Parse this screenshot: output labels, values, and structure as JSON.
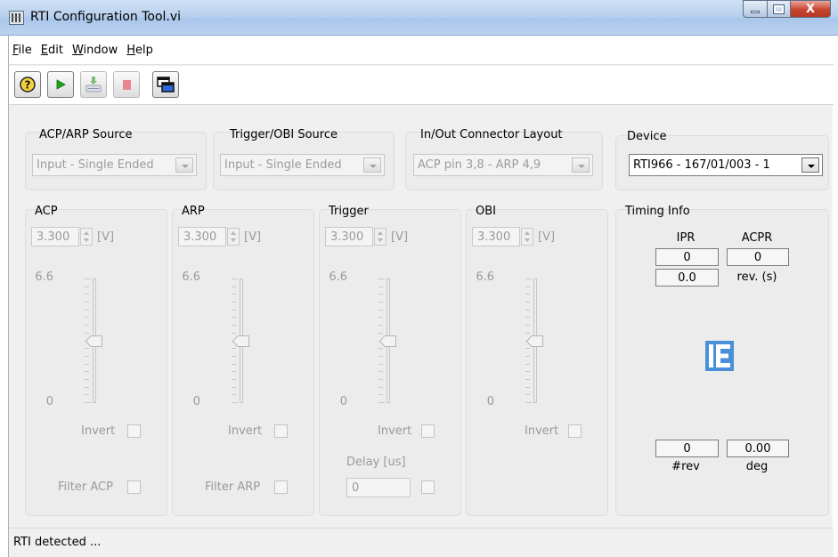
{
  "window": {
    "title": "RTI Configuration Tool.vi",
    "controls": {
      "minimize_icon": "minimize-icon",
      "maximize_icon": "maximize-icon",
      "close_glyph": "X"
    }
  },
  "menu": {
    "items": [
      {
        "accel": "F",
        "rest": "ile"
      },
      {
        "accel": "E",
        "rest": "dit"
      },
      {
        "accel": "W",
        "rest": "indow"
      },
      {
        "accel": "H",
        "rest": "elp"
      }
    ]
  },
  "toolbar": {
    "buttons": [
      {
        "icon": "help-icon",
        "enabled": true
      },
      {
        "icon": "run-icon",
        "enabled": true
      },
      {
        "icon": "download-icon",
        "enabled": false
      },
      {
        "icon": "stop-icon",
        "enabled": false
      },
      {
        "icon": "copy-windows-icon",
        "enabled": true
      }
    ]
  },
  "sources": {
    "acp_arp": {
      "title": "ACP/ARP Source",
      "value": "Input - Single Ended"
    },
    "trigger_obi": {
      "title": "Trigger/OBI Source",
      "value": "Input - Single Ended"
    },
    "connector": {
      "title": "In/Out Connector Layout",
      "value": "ACP pin 3,8 - ARP 4,9"
    },
    "device": {
      "title": "Device",
      "value": "RTI966 - 167/01/003 - 1"
    }
  },
  "channels": [
    {
      "title": "ACP",
      "level": "3.300",
      "unit": "[V]",
      "scale_max": "6.6",
      "scale_min": "0",
      "invert_label": "Invert",
      "filter_label": "Filter ACP",
      "slider_fraction": 0.5
    },
    {
      "title": "ARP",
      "level": "3.300",
      "unit": "[V]",
      "scale_max": "6.6",
      "scale_min": "0",
      "invert_label": "Invert",
      "filter_label": "Filter ARP",
      "slider_fraction": 0.5
    },
    {
      "title": "Trigger",
      "level": "3.300",
      "unit": "[V]",
      "scale_max": "6.6",
      "scale_min": "0",
      "invert_label": "Invert",
      "delay_label": "Delay [us]",
      "delay_value": "0",
      "slider_fraction": 0.5
    },
    {
      "title": "OBI",
      "level": "3.300",
      "unit": "[V]",
      "scale_max": "6.6",
      "scale_min": "0",
      "invert_label": "Invert",
      "slider_fraction": 0.5
    }
  ],
  "timing": {
    "title": "Timing Info",
    "ipr_label": "IPR",
    "acpr_label": "ACPR",
    "ipr_value": "0",
    "acpr_value": "0",
    "rev_time_value": "0.0",
    "rev_time_label": "rev. (s)",
    "logo_icon": "ie-logo-icon",
    "rev_count_value": "0",
    "rev_count_label": "#rev",
    "deg_value": "0.00",
    "deg_label": "deg"
  },
  "status": {
    "text": "RTI detected ..."
  },
  "colors": {
    "logo": "#4a90d9",
    "run_arrow": "#1aa51a",
    "stop": "#e8868f"
  }
}
